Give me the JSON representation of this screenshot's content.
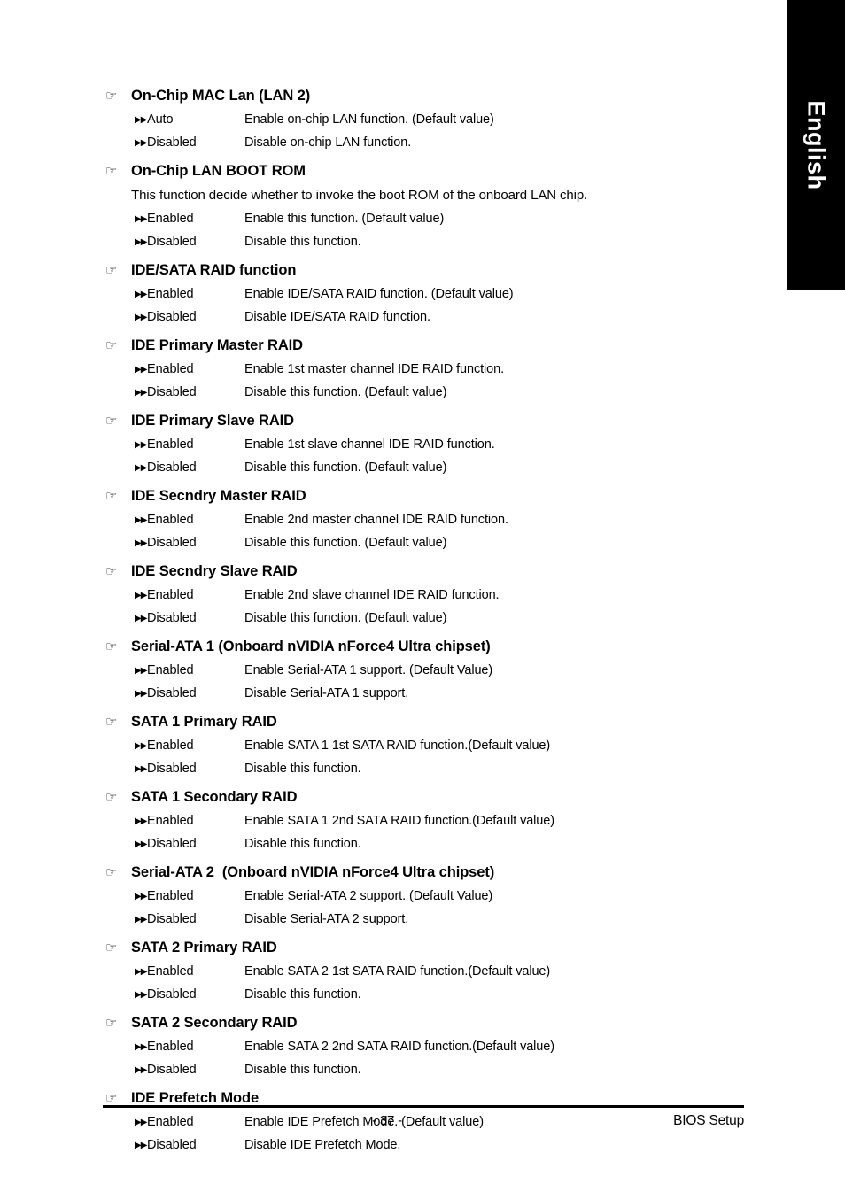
{
  "language_tab": {
    "label": "English"
  },
  "icons": {
    "heading_bullet": "hand-pointer-icon",
    "option_bullet": "double-arrow-icon",
    "heading_bullet_glyph": "☞",
    "option_bullet_glyph": "▶▶"
  },
  "footer": {
    "page_number": "- 37 -",
    "section": "BIOS Setup"
  },
  "entries": [
    {
      "title": "On-Chip MAC Lan (LAN 2)",
      "note": "",
      "options": [
        {
          "name": "Auto",
          "desc": "Enable on-chip LAN function. (Default value)"
        },
        {
          "name": "Disabled",
          "desc": "Disable on-chip LAN function."
        }
      ]
    },
    {
      "title": "On-Chip LAN BOOT ROM",
      "note": "This function decide whether to invoke the boot ROM of the onboard LAN chip.",
      "options": [
        {
          "name": "Enabled",
          "desc": "Enable this function. (Default value)"
        },
        {
          "name": "Disabled",
          "desc": "Disable this function."
        }
      ]
    },
    {
      "title": "IDE/SATA RAID function",
      "note": "",
      "options": [
        {
          "name": "Enabled",
          "desc": "Enable IDE/SATA RAID function. (Default value)"
        },
        {
          "name": "Disabled",
          "desc": "Disable IDE/SATA RAID function."
        }
      ]
    },
    {
      "title": "IDE Primary Master RAID",
      "note": "",
      "options": [
        {
          "name": "Enabled",
          "desc": "Enable 1st master channel IDE RAID function."
        },
        {
          "name": "Disabled",
          "desc": "Disable this function. (Default value)"
        }
      ]
    },
    {
      "title": "IDE Primary Slave RAID",
      "note": "",
      "options": [
        {
          "name": "Enabled",
          "desc": "Enable 1st slave channel IDE RAID function."
        },
        {
          "name": "Disabled",
          "desc": "Disable this function. (Default value)"
        }
      ]
    },
    {
      "title": "IDE Secndry Master RAID",
      "note": "",
      "options": [
        {
          "name": "Enabled",
          "desc": "Enable 2nd master channel IDE RAID function."
        },
        {
          "name": "Disabled",
          "desc": "Disable this function. (Default value)"
        }
      ]
    },
    {
      "title": "IDE Secndry Slave RAID",
      "note": "",
      "options": [
        {
          "name": "Enabled",
          "desc": "Enable 2nd slave channel IDE RAID function."
        },
        {
          "name": "Disabled",
          "desc": "Disable this function. (Default value)"
        }
      ]
    },
    {
      "title": "Serial-ATA 1 (Onboard nVIDIA nForce4 Ultra chipset)",
      "note": "",
      "options": [
        {
          "name": "Enabled",
          "desc": "Enable Serial-ATA 1 support. (Default Value)"
        },
        {
          "name": "Disabled",
          "desc": "Disable Serial-ATA 1 support."
        }
      ]
    },
    {
      "title": "SATA 1 Primary RAID",
      "note": "",
      "options": [
        {
          "name": "Enabled",
          "desc": "Enable SATA 1 1st SATA RAID function.(Default value)"
        },
        {
          "name": "Disabled",
          "desc": "Disable this function."
        }
      ]
    },
    {
      "title": "SATA 1 Secondary RAID",
      "note": "",
      "options": [
        {
          "name": "Enabled",
          "desc": "Enable SATA 1 2nd SATA RAID function.(Default value)"
        },
        {
          "name": "Disabled",
          "desc": "Disable this function."
        }
      ]
    },
    {
      "title": "Serial-ATA 2  (Onboard nVIDIA nForce4 Ultra chipset)",
      "note": "",
      "options": [
        {
          "name": "Enabled",
          "desc": "Enable Serial-ATA 2 support. (Default Value)"
        },
        {
          "name": "Disabled",
          "desc": "Disable Serial-ATA 2 support."
        }
      ]
    },
    {
      "title": "SATA 2 Primary RAID",
      "note": "",
      "options": [
        {
          "name": "Enabled",
          "desc": "Enable SATA 2 1st SATA RAID function.(Default value)"
        },
        {
          "name": "Disabled",
          "desc": "Disable this function."
        }
      ]
    },
    {
      "title": "SATA 2 Secondary RAID",
      "note": "",
      "options": [
        {
          "name": "Enabled",
          "desc": "Enable SATA 2 2nd SATA RAID function.(Default value)"
        },
        {
          "name": "Disabled",
          "desc": "Disable this function."
        }
      ]
    },
    {
      "title": "IDE Prefetch Mode",
      "note": "",
      "options": [
        {
          "name": "Enabled",
          "desc": "Enable IDE Prefetch Mode. (Default value)"
        },
        {
          "name": "Disabled",
          "desc": "Disable IDE Prefetch Mode."
        }
      ]
    }
  ]
}
